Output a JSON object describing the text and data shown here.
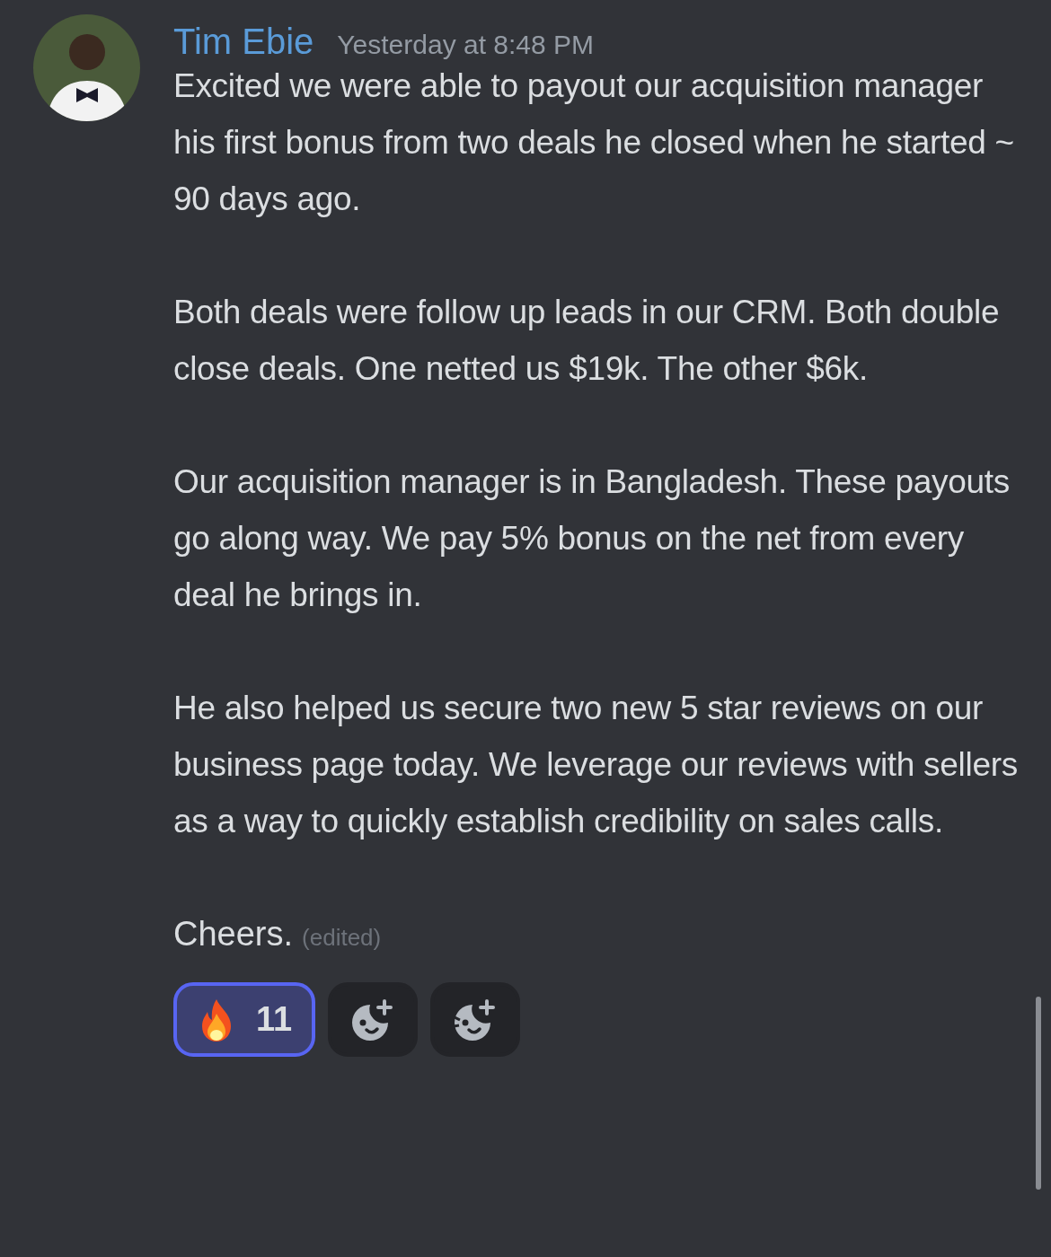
{
  "message": {
    "author": "Tim Ebie",
    "timestamp": "Yesterday at 8:48 PM",
    "paragraphs": [
      "Excited we were able to payout our acquisition manager his first bonus from two deals he closed when he started ~ 90 days ago.",
      "Both deals were follow up leads in our CRM. Both double close deals. One netted us $19k. The other $6k.",
      "Our acquisition manager is in Bangladesh. These payouts go along way. We pay 5% bonus on the net from every deal he brings in.",
      "He also helped us secure two new 5 star reviews on our business page today. We leverage our reviews with sellers as a way to quickly establish credibility on sales calls.",
      "Cheers."
    ],
    "edited": "(edited)"
  },
  "reactions": [
    {
      "kind": "emoji",
      "count": "11",
      "selected": true
    },
    {
      "kind": "add-reaction",
      "selected": false
    },
    {
      "kind": "add-super-reaction",
      "selected": false
    }
  ]
}
